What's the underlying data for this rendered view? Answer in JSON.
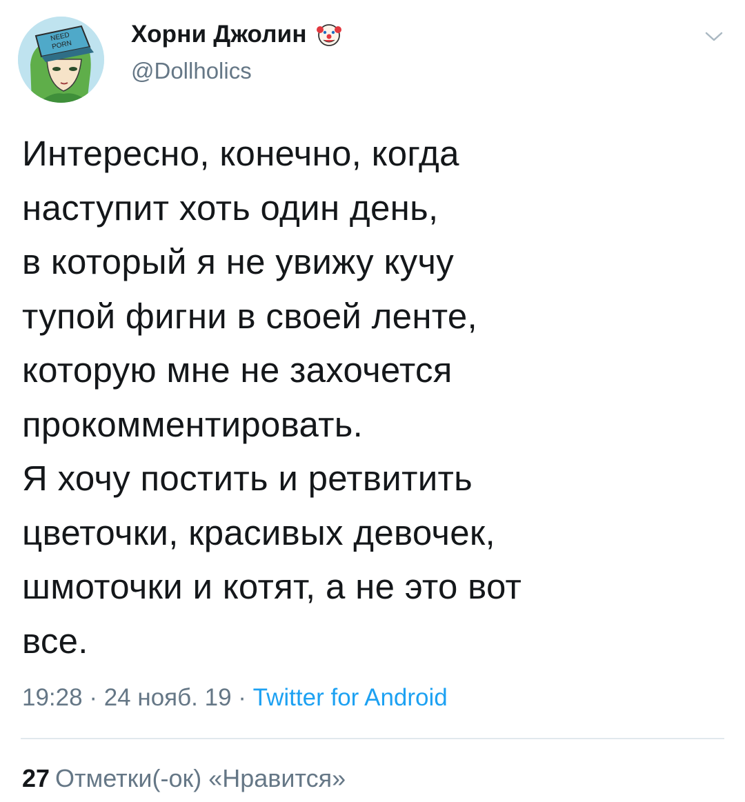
{
  "user": {
    "display_name": "Хорни Джолин",
    "emoji": "clown-face-icon",
    "handle": "@Dollholics",
    "avatar_cap_text": [
      "NEED",
      "PORN"
    ]
  },
  "tweet": {
    "lines": [
      "Интересно, конечно, когда",
      "наступит хоть один день,",
      "в который я не увижу кучу",
      "тупой фигни в своей ленте,",
      "которую мне не захочется",
      "прокомментировать.",
      "Я хочу постить и ретвитить",
      "цветочки, красивых девочек,",
      "шмоточки и котят, а не это вот",
      "все."
    ]
  },
  "meta": {
    "time": "19:28",
    "date": "24 нояб. 19",
    "separator": "·",
    "source": "Twitter for Android"
  },
  "stats": {
    "likes_count": "27",
    "likes_label": "Отметки(-ок) «Нравится»"
  },
  "colors": {
    "text": "#14171a",
    "secondary": "#657786",
    "link": "#1da1f2",
    "divider": "#e1e8ed"
  }
}
